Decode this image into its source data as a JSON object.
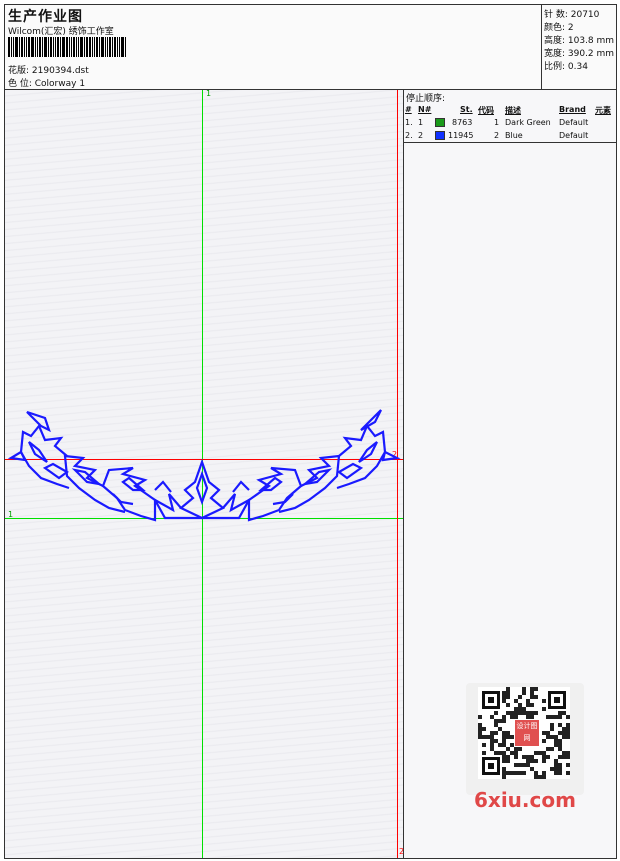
{
  "header": {
    "title": "生产作业图",
    "subtitle": "Wilcom(汇宏) 绣饰工作室",
    "design_label": "花版: 2190394.dst",
    "colorway_label": "色 位:  Colorway 1"
  },
  "stats": {
    "stitches": "针 数: 20710",
    "colors": "颜色: 2",
    "height": "高度: 103.8 mm",
    "width": "宽度: 390.2 mm",
    "scale": "比例: 0.34"
  },
  "stop_sequence": {
    "title": "停止顺序:",
    "columns": [
      "#",
      "N#",
      "St.",
      "代码",
      "描述",
      "Brand",
      "元素"
    ],
    "rows": [
      {
        "index": "1.",
        "needle": "1",
        "color": "#1a9a1a",
        "stitches": "8763",
        "code": "1",
        "description": "Dark Green",
        "brand": "Default"
      },
      {
        "index": "2.",
        "needle": "2",
        "color": "#1030ff",
        "stitches": "11945",
        "code": "2",
        "description": "Blue",
        "brand": "Default"
      }
    ]
  },
  "guides": {
    "green_v_label": "1",
    "green_h_label": "1",
    "red_h_label": "2",
    "red_bottom_label": "2"
  },
  "colors": {
    "design_stroke": "#1a1aff",
    "guide_green": "#00e000",
    "guide_red": "#ff0000"
  },
  "watermark": {
    "seal_text": "设计图网",
    "site_text": "6xiu.com"
  }
}
